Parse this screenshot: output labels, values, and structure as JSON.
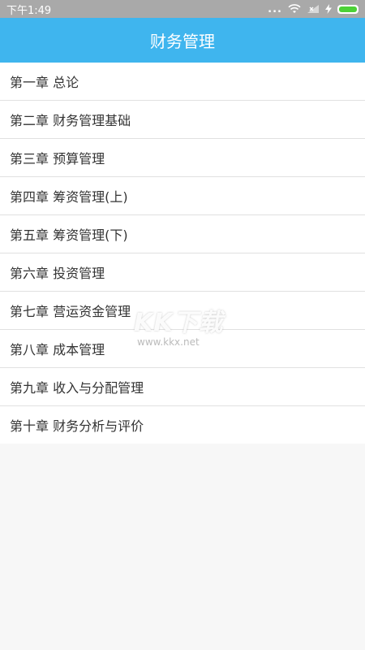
{
  "status_bar": {
    "time": "下午1:49",
    "more": "...",
    "battery_level": 1.0
  },
  "header": {
    "title": "财务管理"
  },
  "chapters": [
    "第一章 总论",
    "第二章 财务管理基础",
    "第三章 预算管理",
    "第四章 筹资管理(上)",
    "第五章 筹资管理(下)",
    "第六章 投资管理",
    "第七章 营运资金管理",
    "第八章 成本管理",
    "第九章 收入与分配管理",
    "第十章 财务分析与评价"
  ],
  "watermark": {
    "logo": "KK下载",
    "url": "www.kkx.net"
  },
  "colors": {
    "header": "#3fb5ee",
    "status_bar": "#a9a9a9",
    "battery": "#4cd137"
  }
}
